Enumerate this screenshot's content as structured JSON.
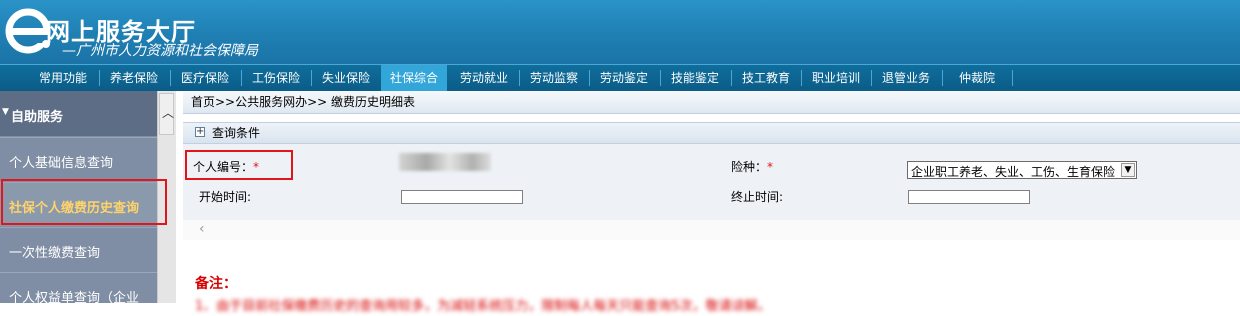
{
  "header": {
    "logo_icon": "e-logo-icon",
    "title": "网上服务大厅",
    "subtitle": "—广州市人力资源和社会保障局"
  },
  "nav": {
    "items": [
      "常用功能",
      "养老保险",
      "医疗保险",
      "工伤保险",
      "失业保险",
      "社保综合",
      "劳动就业",
      "劳动监察",
      "劳动鉴定",
      "技能鉴定",
      "技工教育",
      "职业培训",
      "退管业务",
      "仲裁院"
    ],
    "active": "社保综合",
    "active_color": "#33a6d9"
  },
  "sidebar": {
    "header": "自助服务",
    "items": [
      "个人基础信息查询",
      "社保个人缴费历史查询",
      "一次性缴费查询",
      "个人权益单查询（企业"
    ],
    "active": "社保个人缴费历史查询",
    "highlight_color": "#e0161a"
  },
  "main": {
    "breadcrumb": "首页>>公共服务网办>> 缴费历史明细表",
    "query_section": "查询条件",
    "form": {
      "person_id_label": "个人编号：",
      "required_mark": "*",
      "insurance_label": "险种：",
      "insurance_value": "企业职工养老、失业、工伤、生育保险",
      "start_label": "开始时间:",
      "end_label": "终止时间:"
    },
    "remark_title": "备注：",
    "remark_text": "1、由于目前社保缴费历史的查询用较多，为减轻系统压力，限制每人每天只能查询5次，敬请谅解。"
  }
}
